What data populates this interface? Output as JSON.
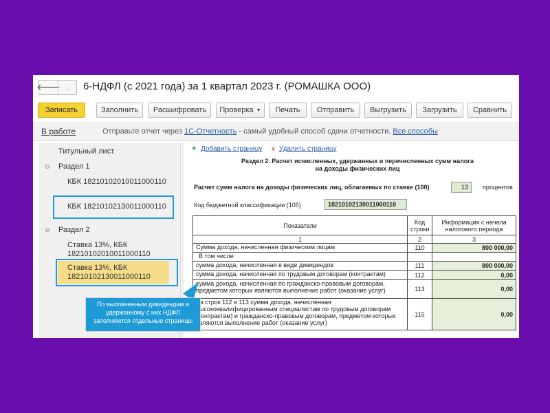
{
  "window": {
    "title": "6-НДФЛ (с 2021 года) за 1 квартал 2023 г. (РОМАШКА ООО)",
    "back_glyph": "🡐",
    "forward_glyph": "→"
  },
  "toolbar": {
    "save": "Записать",
    "fill": "Заполнить",
    "decode": "Расшифровать",
    "check": "Проверка",
    "print": "Печать",
    "send": "Отправить",
    "upload": "Выгрузить",
    "load": "Загрузить",
    "compare": "Сравнить",
    "dropdown_glyph": "▼"
  },
  "infobar": {
    "status": "В работе",
    "text_before": "Отправьте отчет через ",
    "link_1c": "1С-Отчетность",
    "text_after": " - самый удобный способ сдачи отчетности. ",
    "link_all": "Все способы"
  },
  "tree": {
    "toggle_glyph": "⊖",
    "title_page": "Титульный лист",
    "section1": "Раздел 1",
    "kbk1": "КБК 18210102010011000110",
    "kbk2": "КБК 18210102130011000110",
    "section2": "Раздел 2",
    "rate1_line1": "Ставка 13%, КБК",
    "rate1_line2": "18210102010011000110",
    "rate2_line1": "Ставка 13%, КБК",
    "rate2_line2": "18210102130011000110"
  },
  "form": {
    "add_glyph": "+",
    "add_page": "Добавить страницу",
    "del_glyph": "x",
    "delete_page": "Удалить страницу",
    "section_title_1": "Раздел 2. Расчет исчисленных, удержанных и перечисленных сумм налога",
    "section_title_2": "на доходы физических лиц",
    "calc_label": "Расчет сумм налога на доходы физических лиц, облагаемых по ставке   (100)",
    "rate_value": "13",
    "percent_label": "процентов",
    "kbk_label": "Код бюджетной классификации   (105)",
    "kbk_value": "18210102130011000110"
  },
  "table": {
    "headers": [
      "Показатели",
      "Код строки",
      "Информация с начала налогового периода"
    ],
    "col_numbers": [
      "1",
      "2",
      "3"
    ],
    "rows": [
      {
        "label": "Сумма дохода, начисленная физическим лицам",
        "code": "110",
        "value": "800 000,00"
      },
      {
        "label": "В том числе:",
        "code": "",
        "value": ""
      },
      {
        "label": "сумма дохода, начисленная в виде дивидендов",
        "code": "111",
        "value": "800 000,00"
      },
      {
        "label": "сумма дохода, начисленная по трудовым договорам (контрактам)",
        "code": "112",
        "value": "0,00"
      },
      {
        "label": "сумма дохода, начисленная по гражданско-правовым договорам, предметом которых являются выполнение работ (оказание услуг)",
        "code": "113",
        "value": "0,00"
      },
      {
        "label": "Из строк 112 и 113 сумма дохода, начисленная высококвалифицированным специалистам по трудовым договорам (контрактам) и гражданско-правовым договорам, предметом которых являются выполнение работ (оказание услуг)",
        "code": "115",
        "value": "0,00"
      }
    ]
  },
  "callout": {
    "text": "По выплаченным дивидендам и удержанному с них НДФЛ заполняются отдельные страницы"
  }
}
